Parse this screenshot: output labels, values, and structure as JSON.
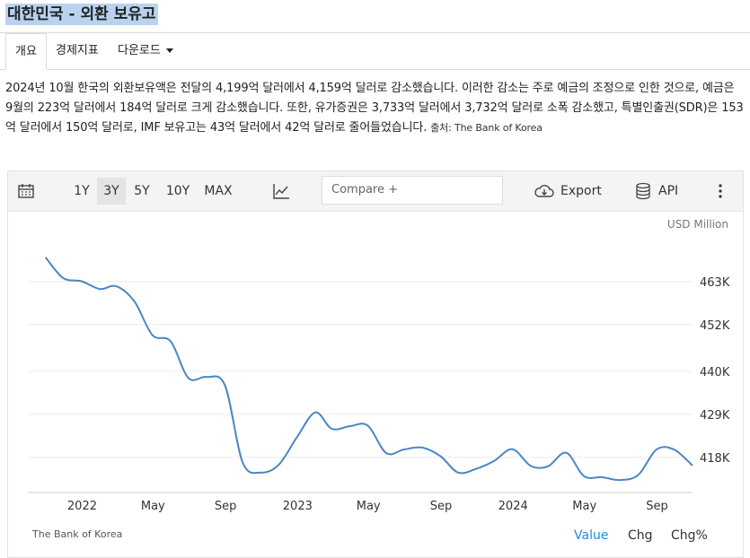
{
  "page": {
    "title": "대한민국 - 외환 보유고",
    "tabs": [
      {
        "label": "개요"
      },
      {
        "label": "경제지표"
      },
      {
        "label": "다운로드"
      }
    ],
    "summary": "2024년 10월 한국의 외환보유액은 전달의 4,199억 달러에서 4,159억 달러로 감소했습니다. 이러한 감소는 주로 예금의 조정으로 인한 것으로, 예금은 9월의 223억 달러에서 184억 달러로 크게 감소했습니다. 또한, 유가증권은 3,733억 달러에서 3,732억 달러로 소폭 감소했고, 특별인출권(SDR)은 153억 달러에서 150억 달러로, IMF 보유고는 43억 달러에서 42억 달러로 줄어들었습니다.",
    "source": "출처: The Bank of Korea"
  },
  "toolbar": {
    "ranges": [
      "1Y",
      "3Y",
      "5Y",
      "10Y",
      "MAX"
    ],
    "selected_range": "3Y",
    "compare_placeholder": "Compare +",
    "export_label": "Export",
    "api_label": "API",
    "icons": [
      "calendar-icon",
      "line-chart-icon",
      "cloud-download-icon",
      "database-icon",
      "more-vertical-icon"
    ]
  },
  "chart_footer": {
    "credit": "The Bank of Korea",
    "views": [
      "Value",
      "Chg",
      "Chg%"
    ],
    "selected_view": "Value",
    "accent": "#1a8fdd"
  },
  "chart_data": {
    "type": "line",
    "unit": "USD Million",
    "line_color": "#4a86c5",
    "ylim": [
      409000,
      474000
    ],
    "yticks": [
      418000,
      429000,
      440000,
      452000,
      463000
    ],
    "ytick_labels": [
      "418K",
      "429K",
      "440K",
      "452K",
      "463K"
    ],
    "xticks": [
      {
        "date": "2022-01-01",
        "label": "2022"
      },
      {
        "date": "2022-05-01",
        "label": "May"
      },
      {
        "date": "2022-09-01",
        "label": "Sep"
      },
      {
        "date": "2023-01-01",
        "label": "2023"
      },
      {
        "date": "2023-05-01",
        "label": "May"
      },
      {
        "date": "2023-09-01",
        "label": "Sep"
      },
      {
        "date": "2024-01-01",
        "label": "2024"
      },
      {
        "date": "2024-05-01",
        "label": "May"
      },
      {
        "date": "2024-09-01",
        "label": "Sep"
      }
    ],
    "xlim": [
      "2021-10-01",
      "2024-10-31"
    ],
    "series": [
      {
        "x": [
          "2021-10-31",
          "2021-11-30",
          "2021-12-31",
          "2022-01-31",
          "2022-02-28",
          "2022-03-31",
          "2022-04-30",
          "2022-05-31",
          "2022-06-30",
          "2022-07-31",
          "2022-08-31",
          "2022-09-30",
          "2022-10-31",
          "2022-11-30",
          "2022-12-31",
          "2023-01-31",
          "2023-02-28",
          "2023-03-31",
          "2023-04-30",
          "2023-05-31",
          "2023-06-30",
          "2023-07-31",
          "2023-08-31",
          "2023-09-30",
          "2023-10-31",
          "2023-11-30",
          "2023-12-31",
          "2024-01-31",
          "2024-02-29",
          "2024-03-31",
          "2024-04-30",
          "2024-05-31",
          "2024-06-30",
          "2024-07-31",
          "2024-08-31",
          "2024-09-30",
          "2024-10-31"
        ],
        "y": [
          469200,
          463900,
          463100,
          461100,
          461800,
          457800,
          449300,
          447700,
          438300,
          438600,
          436400,
          416700,
          414100,
          416100,
          423200,
          429500,
          425300,
          426000,
          426100,
          419100,
          420000,
          420500,
          418300,
          414100,
          415100,
          417100,
          420100,
          415800,
          415700,
          419200,
          413200,
          412900,
          412200,
          413500,
          420000,
          419970,
          415900
        ]
      }
    ]
  }
}
